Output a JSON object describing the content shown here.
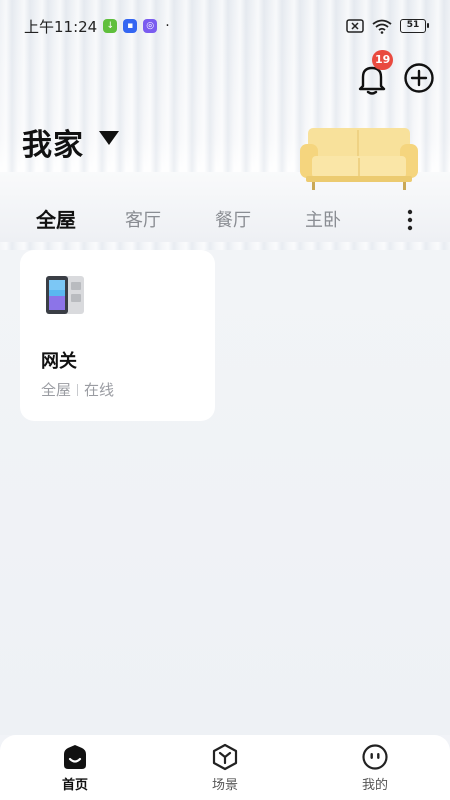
{
  "status_bar": {
    "time": "上午11:24",
    "dot": "·",
    "battery": "51"
  },
  "header": {
    "notification_count": "19",
    "home_name": "我家"
  },
  "tabs": [
    {
      "label": "全屋",
      "active": true
    },
    {
      "label": "客厅",
      "active": false
    },
    {
      "label": "餐厅",
      "active": false
    },
    {
      "label": "主卧",
      "active": false
    }
  ],
  "devices": [
    {
      "name": "网关",
      "room": "全屋",
      "status": "在线"
    }
  ],
  "bottom_nav": [
    {
      "label": "首页",
      "icon": "home-icon",
      "active": true
    },
    {
      "label": "场景",
      "icon": "scene-cube-icon",
      "active": false
    },
    {
      "label": "我的",
      "icon": "profile-face-icon",
      "active": false
    }
  ],
  "colors": {
    "badge": "#e94a3f",
    "sofa": "#f7dc8a",
    "inactive_text": "#8a8d93"
  }
}
